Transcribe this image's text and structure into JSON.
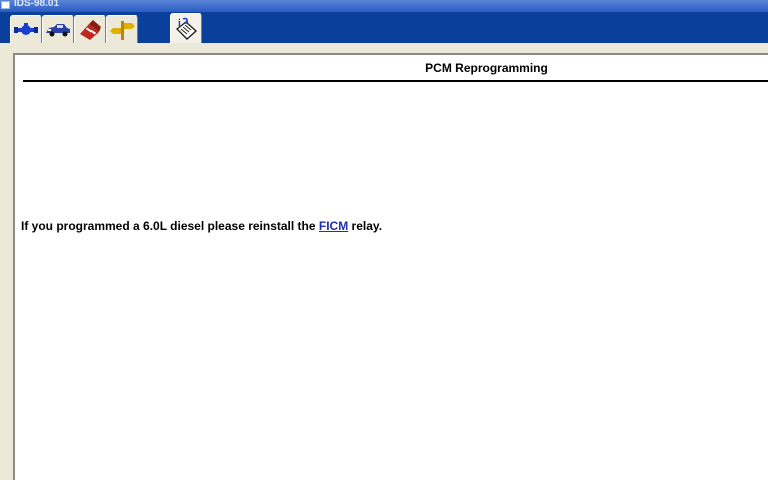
{
  "window": {
    "title": "IDS-98.01"
  },
  "toolbar": {
    "tabs": [
      {
        "name": "connector-icon",
        "state": "normal"
      },
      {
        "name": "vehicle-icon",
        "state": "normal"
      },
      {
        "name": "toolbox-icon",
        "state": "normal"
      },
      {
        "name": "directions-icon",
        "state": "normal"
      },
      {
        "name": "info-checklist-icon",
        "state": "active"
      }
    ]
  },
  "page": {
    "title": "PCM Reprogramming",
    "message_before": "If you programmed a 6.0L diesel please reinstall the ",
    "message_link": "FICM",
    "message_after": " relay."
  },
  "colors": {
    "window_frame": "#0b3f9c",
    "panel_bg": "#ffffff",
    "chrome_bg": "#ece9d8",
    "link": "#1e2fb0"
  }
}
